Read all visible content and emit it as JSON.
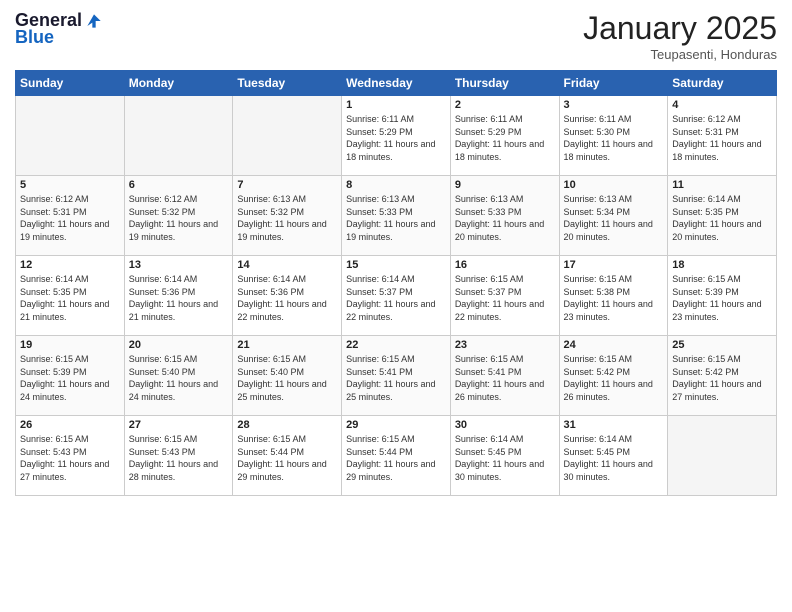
{
  "logo": {
    "general": "General",
    "blue": "Blue"
  },
  "header": {
    "month": "January 2025",
    "location": "Teupasenti, Honduras"
  },
  "weekdays": [
    "Sunday",
    "Monday",
    "Tuesday",
    "Wednesday",
    "Thursday",
    "Friday",
    "Saturday"
  ],
  "weeks": [
    [
      {
        "day": "",
        "info": ""
      },
      {
        "day": "",
        "info": ""
      },
      {
        "day": "",
        "info": ""
      },
      {
        "day": "1",
        "info": "Sunrise: 6:11 AM\nSunset: 5:29 PM\nDaylight: 11 hours and 18 minutes."
      },
      {
        "day": "2",
        "info": "Sunrise: 6:11 AM\nSunset: 5:29 PM\nDaylight: 11 hours and 18 minutes."
      },
      {
        "day": "3",
        "info": "Sunrise: 6:11 AM\nSunset: 5:30 PM\nDaylight: 11 hours and 18 minutes."
      },
      {
        "day": "4",
        "info": "Sunrise: 6:12 AM\nSunset: 5:31 PM\nDaylight: 11 hours and 18 minutes."
      }
    ],
    [
      {
        "day": "5",
        "info": "Sunrise: 6:12 AM\nSunset: 5:31 PM\nDaylight: 11 hours and 19 minutes."
      },
      {
        "day": "6",
        "info": "Sunrise: 6:12 AM\nSunset: 5:32 PM\nDaylight: 11 hours and 19 minutes."
      },
      {
        "day": "7",
        "info": "Sunrise: 6:13 AM\nSunset: 5:32 PM\nDaylight: 11 hours and 19 minutes."
      },
      {
        "day": "8",
        "info": "Sunrise: 6:13 AM\nSunset: 5:33 PM\nDaylight: 11 hours and 19 minutes."
      },
      {
        "day": "9",
        "info": "Sunrise: 6:13 AM\nSunset: 5:33 PM\nDaylight: 11 hours and 20 minutes."
      },
      {
        "day": "10",
        "info": "Sunrise: 6:13 AM\nSunset: 5:34 PM\nDaylight: 11 hours and 20 minutes."
      },
      {
        "day": "11",
        "info": "Sunrise: 6:14 AM\nSunset: 5:35 PM\nDaylight: 11 hours and 20 minutes."
      }
    ],
    [
      {
        "day": "12",
        "info": "Sunrise: 6:14 AM\nSunset: 5:35 PM\nDaylight: 11 hours and 21 minutes."
      },
      {
        "day": "13",
        "info": "Sunrise: 6:14 AM\nSunset: 5:36 PM\nDaylight: 11 hours and 21 minutes."
      },
      {
        "day": "14",
        "info": "Sunrise: 6:14 AM\nSunset: 5:36 PM\nDaylight: 11 hours and 22 minutes."
      },
      {
        "day": "15",
        "info": "Sunrise: 6:14 AM\nSunset: 5:37 PM\nDaylight: 11 hours and 22 minutes."
      },
      {
        "day": "16",
        "info": "Sunrise: 6:15 AM\nSunset: 5:37 PM\nDaylight: 11 hours and 22 minutes."
      },
      {
        "day": "17",
        "info": "Sunrise: 6:15 AM\nSunset: 5:38 PM\nDaylight: 11 hours and 23 minutes."
      },
      {
        "day": "18",
        "info": "Sunrise: 6:15 AM\nSunset: 5:39 PM\nDaylight: 11 hours and 23 minutes."
      }
    ],
    [
      {
        "day": "19",
        "info": "Sunrise: 6:15 AM\nSunset: 5:39 PM\nDaylight: 11 hours and 24 minutes."
      },
      {
        "day": "20",
        "info": "Sunrise: 6:15 AM\nSunset: 5:40 PM\nDaylight: 11 hours and 24 minutes."
      },
      {
        "day": "21",
        "info": "Sunrise: 6:15 AM\nSunset: 5:40 PM\nDaylight: 11 hours and 25 minutes."
      },
      {
        "day": "22",
        "info": "Sunrise: 6:15 AM\nSunset: 5:41 PM\nDaylight: 11 hours and 25 minutes."
      },
      {
        "day": "23",
        "info": "Sunrise: 6:15 AM\nSunset: 5:41 PM\nDaylight: 11 hours and 26 minutes."
      },
      {
        "day": "24",
        "info": "Sunrise: 6:15 AM\nSunset: 5:42 PM\nDaylight: 11 hours and 26 minutes."
      },
      {
        "day": "25",
        "info": "Sunrise: 6:15 AM\nSunset: 5:42 PM\nDaylight: 11 hours and 27 minutes."
      }
    ],
    [
      {
        "day": "26",
        "info": "Sunrise: 6:15 AM\nSunset: 5:43 PM\nDaylight: 11 hours and 27 minutes."
      },
      {
        "day": "27",
        "info": "Sunrise: 6:15 AM\nSunset: 5:43 PM\nDaylight: 11 hours and 28 minutes."
      },
      {
        "day": "28",
        "info": "Sunrise: 6:15 AM\nSunset: 5:44 PM\nDaylight: 11 hours and 29 minutes."
      },
      {
        "day": "29",
        "info": "Sunrise: 6:15 AM\nSunset: 5:44 PM\nDaylight: 11 hours and 29 minutes."
      },
      {
        "day": "30",
        "info": "Sunrise: 6:14 AM\nSunset: 5:45 PM\nDaylight: 11 hours and 30 minutes."
      },
      {
        "day": "31",
        "info": "Sunrise: 6:14 AM\nSunset: 5:45 PM\nDaylight: 11 hours and 30 minutes."
      },
      {
        "day": "",
        "info": ""
      }
    ]
  ]
}
